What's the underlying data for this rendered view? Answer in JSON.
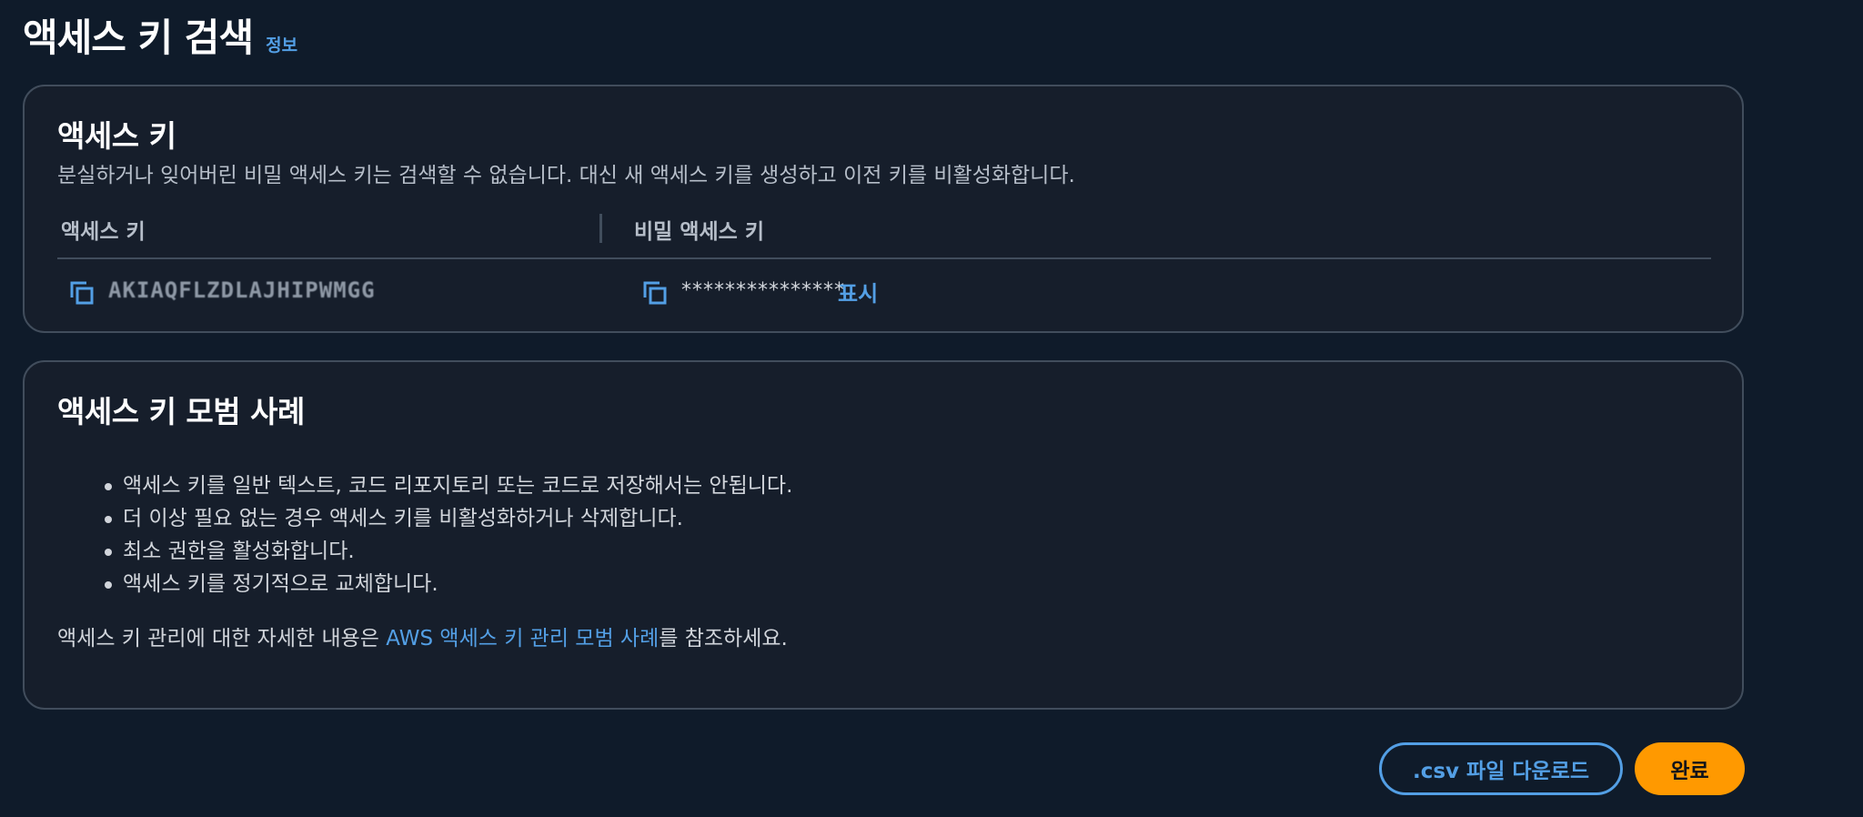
{
  "header": {
    "title": "액세스 키 검색",
    "info_link": "정보"
  },
  "access_key_panel": {
    "title": "액세스 키",
    "description": "분실하거나 잊어버린 비밀 액세스 키는 검색할 수 없습니다. 대신 새 액세스 키를 생성하고 이전 키를 비활성화합니다.",
    "col_access_key": "액세스 키",
    "col_secret_key": "비밀 액세스 키",
    "access_key_value": "AKIAQFLZDLAJHIPWMGG",
    "secret_key_masked": "***************",
    "show_label": "표시"
  },
  "best_practices_panel": {
    "title": "액세스 키 모범 사례",
    "tips": [
      "액세스 키를 일반 텍스트, 코드 리포지토리 또는 코드로 저장해서는 안됩니다.",
      "더 이상 필요 없는 경우 액세스 키를 비활성화하거나 삭제합니다.",
      "최소 권한을 활성화합니다.",
      "액세스 키를 정기적으로 교체합니다."
    ],
    "footnote_prefix": "액세스 키 관리에 대한 자세한 내용은 ",
    "footnote_link": "AWS 액세스 키 관리 모범 사례",
    "footnote_suffix": "를 참조하세요."
  },
  "actions": {
    "download_csv": ".csv 파일 다운로드",
    "done": "완료"
  },
  "colors": {
    "background": "#0f1b2a",
    "panel": "#161e2b",
    "link": "#539fe5",
    "primary": "#ff9900"
  }
}
